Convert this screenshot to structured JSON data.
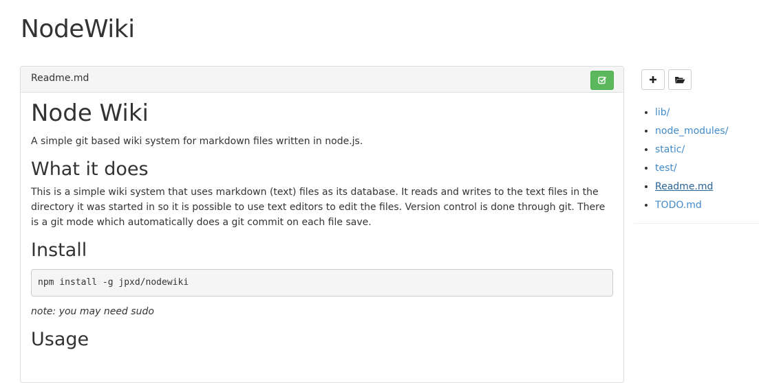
{
  "site": {
    "title": "NodeWiki"
  },
  "panel": {
    "filename": "Readme.md",
    "edit_icon": "edit-check-icon",
    "accent": "#5cb85c"
  },
  "doc": {
    "h1": "Node Wiki",
    "intro": "A simple git based wiki system for markdown files written in node.js.",
    "what_heading": "What it does",
    "what_text": "This is a simple wiki system that uses markdown (text) files as its database. It reads and writes to the text files in the directory it was started in so it is possible to use text editors to edit the files. Version control is done through git. There is a git mode which automatically does a git commit on each file save.",
    "install_heading": "Install",
    "install_code": "npm install -g jpxd/nodewiki",
    "install_note": "note: you may need sudo",
    "usage_heading": "Usage"
  },
  "sidebar": {
    "new_icon": "plus-icon",
    "open_icon": "folder-open-icon",
    "files": [
      {
        "label": "lib/"
      },
      {
        "label": "node_modules/"
      },
      {
        "label": "static/"
      },
      {
        "label": "test/"
      },
      {
        "label": "Readme.md",
        "active": true
      },
      {
        "label": "TODO.md"
      }
    ],
    "link_color": "#428bca"
  }
}
